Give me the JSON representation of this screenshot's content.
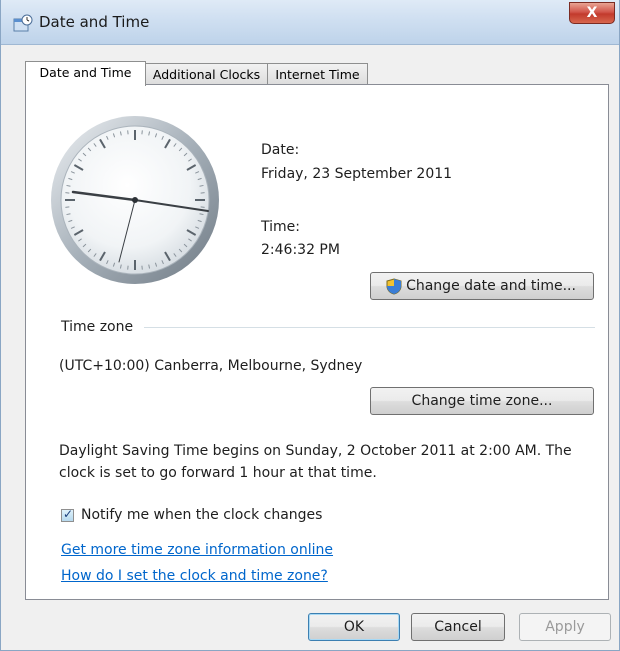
{
  "window": {
    "title": "Date and Time",
    "close_label": "X"
  },
  "tabs": [
    {
      "label": "Date and Time"
    },
    {
      "label": "Additional Clocks"
    },
    {
      "label": "Internet Time"
    }
  ],
  "datetime": {
    "date_label": "Date:",
    "date_value": "Friday, 23 September 2011",
    "time_label": "Time:",
    "time_value": "2:46:32 PM",
    "change_button": "Change date and time..."
  },
  "timezone": {
    "section_label": "Time zone",
    "value": "(UTC+10:00) Canberra, Melbourne, Sydney",
    "change_button": "Change time zone..."
  },
  "dst_notice": {
    "line1": "Daylight Saving Time begins on Sunday, 2 October 2011 at 2:00 AM. The",
    "line2": "clock is set to go forward 1 hour at that time."
  },
  "notify": {
    "label": "Notify me when the clock changes",
    "checked": true
  },
  "links": {
    "more_info": "Get more time zone information online",
    "how_to": "How do I set the clock and time zone?"
  },
  "footer": {
    "ok": "OK",
    "cancel": "Cancel",
    "apply": "Apply"
  },
  "colors": {
    "link": "#0066cc",
    "close_button": "#c8453a",
    "titlebar": "#cfdff1"
  },
  "icons": {
    "app": "clock-app-icon",
    "shield": "uac-shield-icon"
  }
}
